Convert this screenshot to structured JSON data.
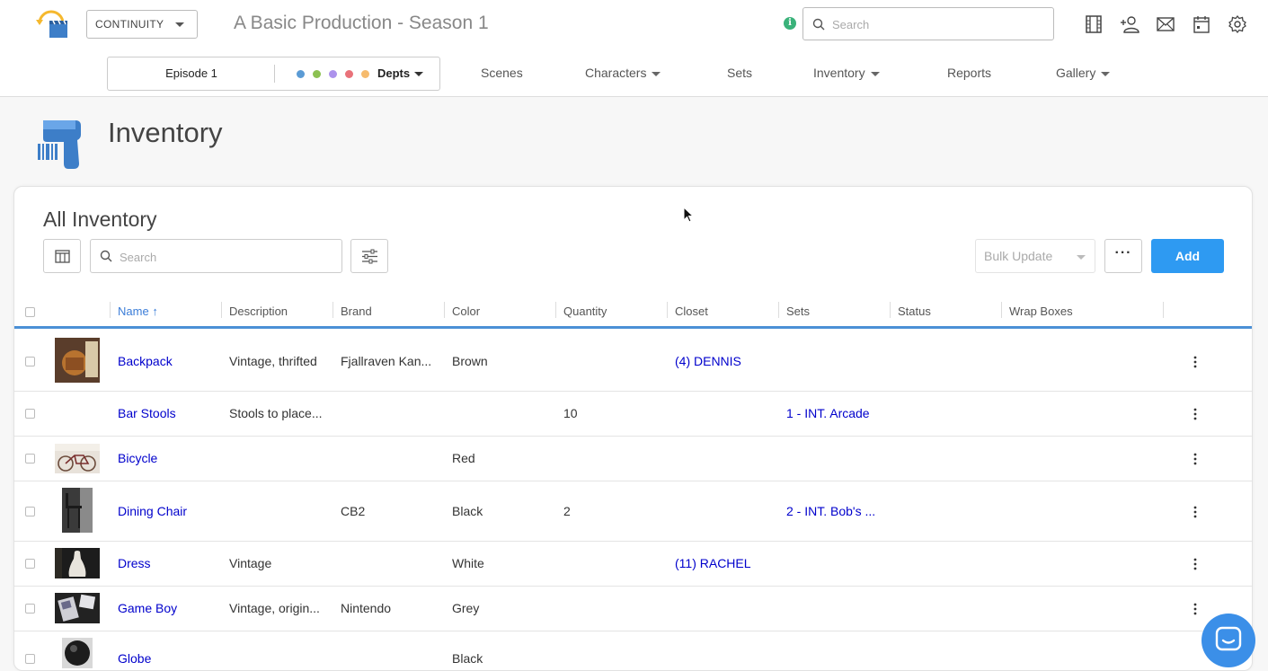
{
  "header": {
    "production_select": "CONTINUITY",
    "production_title": "A Basic Production - Season 1",
    "search_placeholder": "Search",
    "info_glyph": "i",
    "icons": [
      "film-icon",
      "add-person-icon",
      "mail-icon",
      "calendar-icon",
      "gear-icon"
    ]
  },
  "nav": {
    "episode": "Episode 1",
    "depts": "Depts",
    "dept_colors": [
      "#5b9bd5",
      "#8cc152",
      "#ac92ec",
      "#e9727a",
      "#f6bb6e"
    ],
    "items": [
      {
        "label": "Scenes",
        "dropdown": false
      },
      {
        "label": "Characters",
        "dropdown": true
      },
      {
        "label": "Sets",
        "dropdown": false
      },
      {
        "label": "Inventory",
        "dropdown": true
      },
      {
        "label": "Reports",
        "dropdown": false
      },
      {
        "label": "Gallery",
        "dropdown": true
      }
    ]
  },
  "page": {
    "title": "Inventory"
  },
  "panel": {
    "title": "All Inventory",
    "search_placeholder": "Search",
    "bulk_update": "Bulk Update",
    "add_label": "Add",
    "more_label": "···"
  },
  "table": {
    "columns": [
      "Name",
      "Description",
      "Brand",
      "Color",
      "Quantity",
      "Closet",
      "Sets",
      "Status",
      "Wrap Boxes"
    ],
    "sort_indicator": "↑",
    "rows": [
      {
        "name": "Backpack",
        "description": "Vintage, thrifted",
        "brand": "Fjallraven Kan...",
        "color": "Brown",
        "quantity": "",
        "closet": "(4) DENNIS",
        "sets": "",
        "thumb": "backpack"
      },
      {
        "name": "Bar Stools",
        "description": "Stools to place...",
        "brand": "",
        "color": "",
        "quantity": "10",
        "closet": "",
        "sets": "1 - INT. Arcade",
        "thumb": ""
      },
      {
        "name": "Bicycle",
        "description": "",
        "brand": "",
        "color": "Red",
        "quantity": "",
        "closet": "",
        "sets": "",
        "thumb": "bicycle"
      },
      {
        "name": "Dining Chair",
        "description": "",
        "brand": "CB2",
        "color": "Black",
        "quantity": "2",
        "closet": "",
        "sets": "2 - INT. Bob's ...",
        "thumb": "chair"
      },
      {
        "name": "Dress",
        "description": "Vintage",
        "brand": "",
        "color": "White",
        "quantity": "",
        "closet": "(11) RACHEL",
        "sets": "",
        "thumb": "dress"
      },
      {
        "name": "Game Boy",
        "description": "Vintage, origin...",
        "brand": "Nintendo",
        "color": "Grey",
        "quantity": "",
        "closet": "",
        "sets": "",
        "thumb": "gameboy"
      },
      {
        "name": "Globe",
        "description": "",
        "brand": "",
        "color": "Black",
        "quantity": "",
        "closet": "",
        "sets": "",
        "thumb": "globe"
      }
    ]
  },
  "colors": {
    "accent": "#2e9af2",
    "link": "#0000cc",
    "table_border": "#4b90d6",
    "chat": "#3b8fe8"
  }
}
